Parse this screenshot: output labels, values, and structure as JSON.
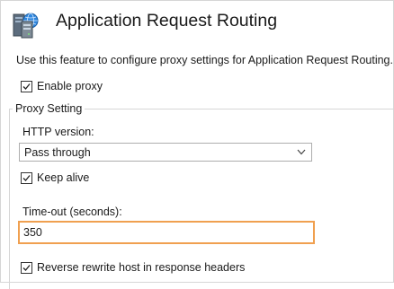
{
  "header": {
    "title": "Application Request Routing",
    "icon": "server-icon"
  },
  "description": "Use this feature to configure proxy settings for Application Request Routing.",
  "enable_proxy": {
    "label": "Enable proxy",
    "checked": true
  },
  "proxy_setting": {
    "legend": "Proxy Setting",
    "http_version": {
      "label": "HTTP version:",
      "selected": "Pass through"
    },
    "keep_alive": {
      "label": "Keep alive",
      "checked": true
    },
    "timeout": {
      "label": "Time-out (seconds):",
      "value": "350",
      "focus_color": "#f0a050"
    },
    "reverse_rewrite": {
      "label": "Reverse rewrite host in response headers",
      "checked": true
    }
  }
}
